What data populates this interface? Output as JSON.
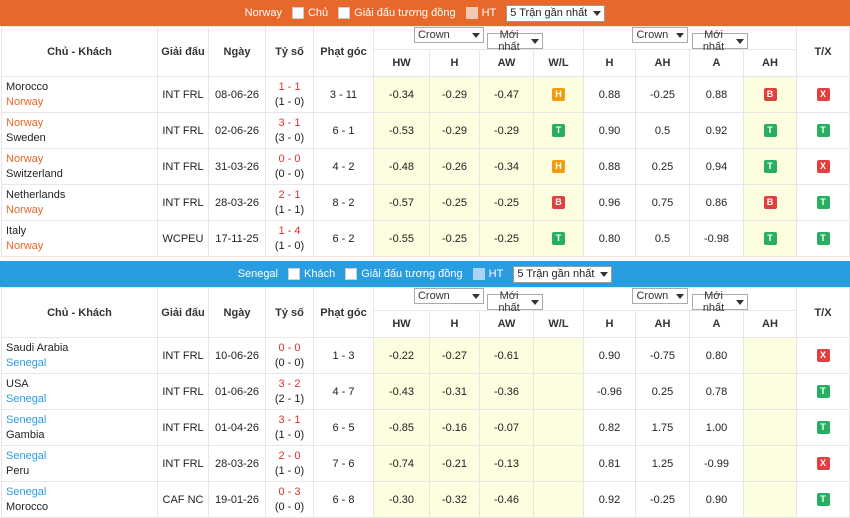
{
  "top": {
    "team": "Norway",
    "opt1": "Chủ",
    "opt2": "Giải đấu tương đồng",
    "opt3": "HT",
    "select": "5 Trận gần nhất",
    "headers": {
      "teams": "Chủ - Khách",
      "league": "Giải đấu",
      "date": "Ngày",
      "score": "Tỷ số",
      "corner": "Phạt góc",
      "sel1": "Crown",
      "sel2": "Mới nhất",
      "sel3": "Crown",
      "sel4": "Mới nhất",
      "tx": "T/X",
      "hw": "HW",
      "h": "H",
      "aw": "AW",
      "wl": "W/L",
      "h2": "H",
      "ah": "AH",
      "a": "A",
      "ah2": "AH"
    },
    "rows": [
      {
        "home": "Morocco",
        "away": "Norway",
        "hl": "away",
        "league": "INT FRL",
        "date": "08-06-26",
        "ft": "1 - 1",
        "ht": "(1 - 0)",
        "corner": "3 - 11",
        "hw": "-0.34",
        "h": "-0.29",
        "aw": "-0.47",
        "wl": "H",
        "oh": "0.88",
        "oah": "-0.25",
        "oa": "0.88",
        "ahr": "B",
        "tx": "X"
      },
      {
        "home": "Norway",
        "away": "Sweden",
        "hl": "home",
        "league": "INT FRL",
        "date": "02-06-26",
        "ft": "3 - 1",
        "ht": "(3 - 0)",
        "corner": "6 - 1",
        "hw": "-0.53",
        "h": "-0.29",
        "aw": "-0.29",
        "wl": "T",
        "oh": "0.90",
        "oah": "0.5",
        "oa": "0.92",
        "ahr": "T",
        "tx": "T"
      },
      {
        "home": "Norway",
        "away": "Switzerland",
        "hl": "home",
        "league": "INT FRL",
        "date": "31-03-26",
        "ft": "0 - 0",
        "ht": "(0 - 0)",
        "corner": "4 - 2",
        "hw": "-0.48",
        "h": "-0.26",
        "aw": "-0.34",
        "wl": "H",
        "oh": "0.88",
        "oah": "0.25",
        "oa": "0.94",
        "ahr": "T",
        "tx": "X"
      },
      {
        "home": "Netherlands",
        "away": "Norway",
        "hl": "away",
        "league": "INT FRL",
        "date": "28-03-26",
        "ft": "2 - 1",
        "ht": "(1 - 1)",
        "corner": "8 - 2",
        "hw": "-0.57",
        "h": "-0.25",
        "aw": "-0.25",
        "wl": "B",
        "oh": "0.96",
        "oah": "0.75",
        "oa": "0.86",
        "ahr": "B",
        "tx": "T"
      },
      {
        "home": "Italy",
        "away": "Norway",
        "hl": "away",
        "league": "WCPEU",
        "date": "17-11-25",
        "ft": "1 - 4",
        "ht": "(1 - 0)",
        "corner": "6 - 2",
        "hw": "-0.55",
        "h": "-0.25",
        "aw": "-0.25",
        "wl": "T",
        "oh": "0.80",
        "oah": "0.5",
        "oa": "-0.98",
        "ahr": "T",
        "tx": "T"
      }
    ]
  },
  "bottom": {
    "team": "Senegal",
    "opt1": "Khách",
    "opt2": "Giải đấu tương đồng",
    "opt3": "HT",
    "select": "5 Trận gần nhất",
    "headers": {
      "teams": "Chủ - Khách",
      "league": "Giải đấu",
      "date": "Ngày",
      "score": "Tỷ số",
      "corner": "Phạt góc",
      "sel1": "Crown",
      "sel2": "Mới nhất",
      "sel3": "Crown",
      "sel4": "Mới nhất",
      "tx": "T/X",
      "hw": "HW",
      "h": "H",
      "aw": "AW",
      "wl": "W/L",
      "h2": "H",
      "ah": "AH",
      "a": "A",
      "ah2": "AH"
    },
    "rows": [
      {
        "home": "Saudi Arabia",
        "away": "Senegal",
        "hl": "away",
        "league": "INT FRL",
        "date": "10-06-26",
        "ft": "0 - 0",
        "ht": "(0 - 0)",
        "corner": "1 - 3",
        "hw": "-0.22",
        "h": "-0.27",
        "aw": "-0.61",
        "wl": "",
        "oh": "0.90",
        "oah": "-0.75",
        "oa": "0.80",
        "ahr": "",
        "tx": "X"
      },
      {
        "home": "USA",
        "away": "Senegal",
        "hl": "away",
        "league": "INT FRL",
        "date": "01-06-26",
        "ft": "3 - 2",
        "ht": "(2 - 1)",
        "corner": "4 - 7",
        "hw": "-0.43",
        "h": "-0.31",
        "aw": "-0.36",
        "wl": "",
        "oh": "-0.96",
        "oah": "0.25",
        "oa": "0.78",
        "ahr": "",
        "tx": "T"
      },
      {
        "home": "Senegal",
        "away": "Gambia",
        "hl": "home",
        "league": "INT FRL",
        "date": "01-04-26",
        "ft": "3 - 1",
        "ht": "(1 - 0)",
        "corner": "6 - 5",
        "hw": "-0.85",
        "h": "-0.16",
        "aw": "-0.07",
        "wl": "",
        "oh": "0.82",
        "oah": "1.75",
        "oa": "1.00",
        "ahr": "",
        "tx": "T"
      },
      {
        "home": "Senegal",
        "away": "Peru",
        "hl": "home",
        "league": "INT FRL",
        "date": "28-03-26",
        "ft": "2 - 0",
        "ht": "(1 - 0)",
        "corner": "7 - 6",
        "hw": "-0.74",
        "h": "-0.21",
        "aw": "-0.13",
        "wl": "",
        "oh": "0.81",
        "oah": "1.25",
        "oa": "-0.99",
        "ahr": "",
        "tx": "X"
      },
      {
        "home": "Senegal",
        "away": "Morocco",
        "hl": "home",
        "league": "CAF NC",
        "date": "19-01-26",
        "ft": "0 - 3",
        "ht": "(0 - 0)",
        "corner": "6 - 8",
        "hw": "-0.30",
        "h": "-0.32",
        "aw": "-0.46",
        "wl": "",
        "oh": "0.92",
        "oah": "-0.25",
        "oa": "0.90",
        "ahr": "",
        "tx": "T"
      }
    ]
  },
  "colors": {
    "orange": "#e8672a",
    "blue": "#2a9ce0"
  }
}
